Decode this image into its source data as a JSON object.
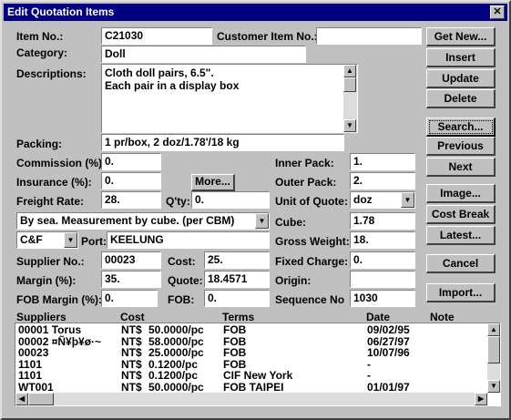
{
  "window": {
    "title": "Edit Quotation Items",
    "close_glyph": "✕"
  },
  "labels": {
    "item_no": "Item No.:",
    "customer_item_no": "Customer Item No.:",
    "category": "Category:",
    "descriptions": "Descriptions:",
    "packing": "Packing:",
    "commission": "Commission (%):",
    "insurance": "Insurance (%):",
    "freight_rate": "Freight Rate:",
    "qty": "Q'ty:",
    "port": "Port:",
    "supplier_no": "Supplier No.:",
    "cost": "Cost:",
    "margin": "Margin (%):",
    "quote": "Quote:",
    "fob_margin": "FOB Margin (%):",
    "fob": "FOB:",
    "inner_pack": "Inner Pack:",
    "outer_pack": "Outer Pack:",
    "unit_of_quote": "Unit of Quote:",
    "cube": "Cube:",
    "gross_weight": "Gross Weight:",
    "fixed_charge": "Fixed Charge:",
    "origin": "Origin:",
    "sequence_no": "Sequence No"
  },
  "fields": {
    "item_no": "C21030",
    "customer_item_no": "",
    "category": "Doll",
    "description_line1": "Cloth doll pairs, 6.5\".",
    "description_line2": "Each pair in a display box",
    "packing": "1 pr/box, 2 doz/1.78'/18 kg",
    "commission": "0.",
    "insurance": "0.",
    "freight_rate": "28.",
    "qty": "0.",
    "shipping_method": "By sea. Measurement by cube. (per CBM)",
    "terms": "C&F",
    "port": "KEELUNG",
    "supplier_no": "00023",
    "cost": "25.",
    "margin": "35.",
    "quote": "18.4571",
    "fob_margin": "0.",
    "fob": "0.",
    "inner_pack": "1.",
    "outer_pack": "2.",
    "unit_of_quote": "doz",
    "cube": "1.78",
    "gross_weight": "18.",
    "fixed_charge": "0.",
    "origin": "",
    "sequence_no": "1030"
  },
  "buttons": {
    "get_new": "Get New...",
    "insert": "Insert",
    "update": "Update",
    "delete": "Delete",
    "search": "Search...",
    "previous": "Previous",
    "next": "Next",
    "image": "Image...",
    "cost_break": "Cost Break",
    "latest": "Latest...",
    "cancel": "Cancel",
    "import": "Import...",
    "more": "More..."
  },
  "suppliers_table": {
    "headers": {
      "suppliers": "Suppliers",
      "cost": "Cost",
      "terms": "Terms",
      "date": "Date",
      "note": "Note"
    },
    "rows": [
      {
        "supplier": "00001 Torus",
        "currency": "NT$",
        "cost": "50.0000/pc",
        "terms": "FOB",
        "date": "09/02/95"
      },
      {
        "supplier": "00002 ¤Ñ¥þ¥ø·~",
        "currency": "NT$",
        "cost": "58.0000/pc",
        "terms": "FOB",
        "date": "06/27/97"
      },
      {
        "supplier": "00023",
        "currency": "NT$",
        "cost": "25.0000/pc",
        "terms": "FOB",
        "date": "10/07/96"
      },
      {
        "supplier": "1101",
        "currency": "NT$",
        "cost": "0.1200/pc",
        "terms": "FOB",
        "date": "-"
      },
      {
        "supplier": "1101",
        "currency": "NT$",
        "cost": "0.1200/pc",
        "terms": "CIF New York",
        "date": "-"
      },
      {
        "supplier": "WT001",
        "currency": "NT$",
        "cost": "50.0000/pc",
        "terms": "FOB TAIPEI",
        "date": "01/01/97"
      }
    ]
  },
  "icons": {
    "up": "▲",
    "down": "▼",
    "left": "◀",
    "right": "▶"
  }
}
